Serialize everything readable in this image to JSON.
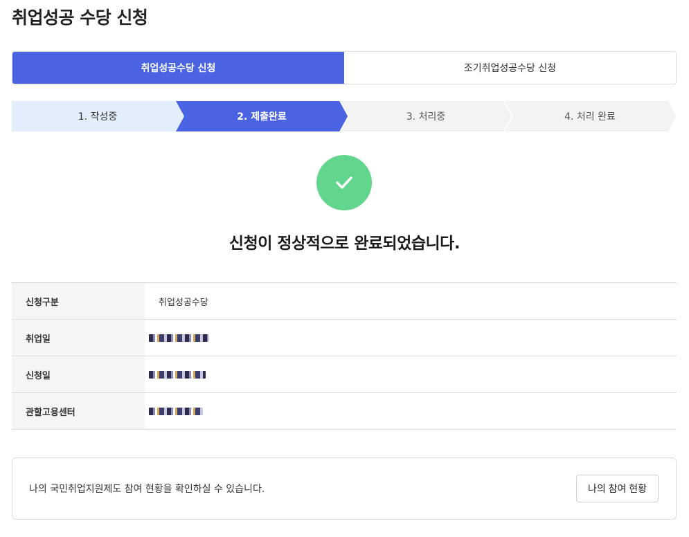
{
  "page": {
    "title": "취업성공 수당 신청"
  },
  "tabs": [
    {
      "label": "취업성공수당 신청",
      "active": true
    },
    {
      "label": "조기취업성공수당 신청",
      "active": false
    }
  ],
  "steps": [
    {
      "label": "1. 작성중",
      "state": "completed"
    },
    {
      "label": "2. 제출완료",
      "state": "current"
    },
    {
      "label": "3. 처리중",
      "state": "pending"
    },
    {
      "label": "4. 처리 완료",
      "state": "pending"
    }
  ],
  "status": {
    "icon": "check-icon",
    "message": "신청이 정상적으로 완료되었습니다."
  },
  "info": {
    "rows": [
      {
        "key": "신청구분",
        "value": "취업성공수당"
      },
      {
        "key": "취업일",
        "value": ""
      },
      {
        "key": "신청일",
        "value": ""
      },
      {
        "key": "관할고용센터",
        "value": ""
      }
    ]
  },
  "notice": {
    "text": "나의 국민취업지원제도 참여 현황을 확인하실 수 있습니다.",
    "button_label": "나의 참여 현황"
  },
  "colors": {
    "accent": "#4a63e2",
    "step_completed_bg": "#e3eefc",
    "step_pending_bg": "#f3f3f3",
    "success": "#62d58e"
  }
}
